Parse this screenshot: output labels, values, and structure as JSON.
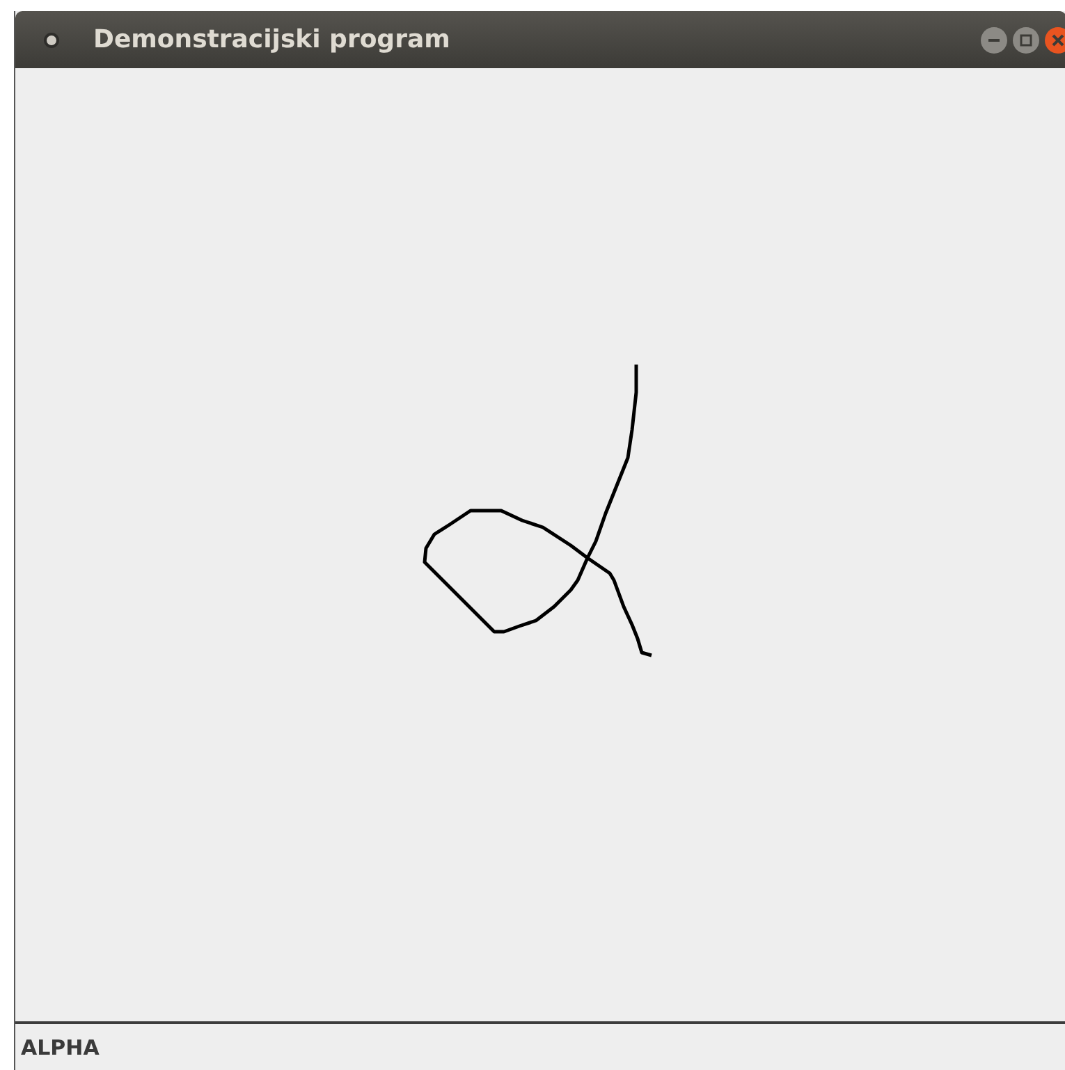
{
  "window": {
    "title": "Demonstracijski program"
  },
  "status_bar": {
    "text": "ALPHA"
  }
}
